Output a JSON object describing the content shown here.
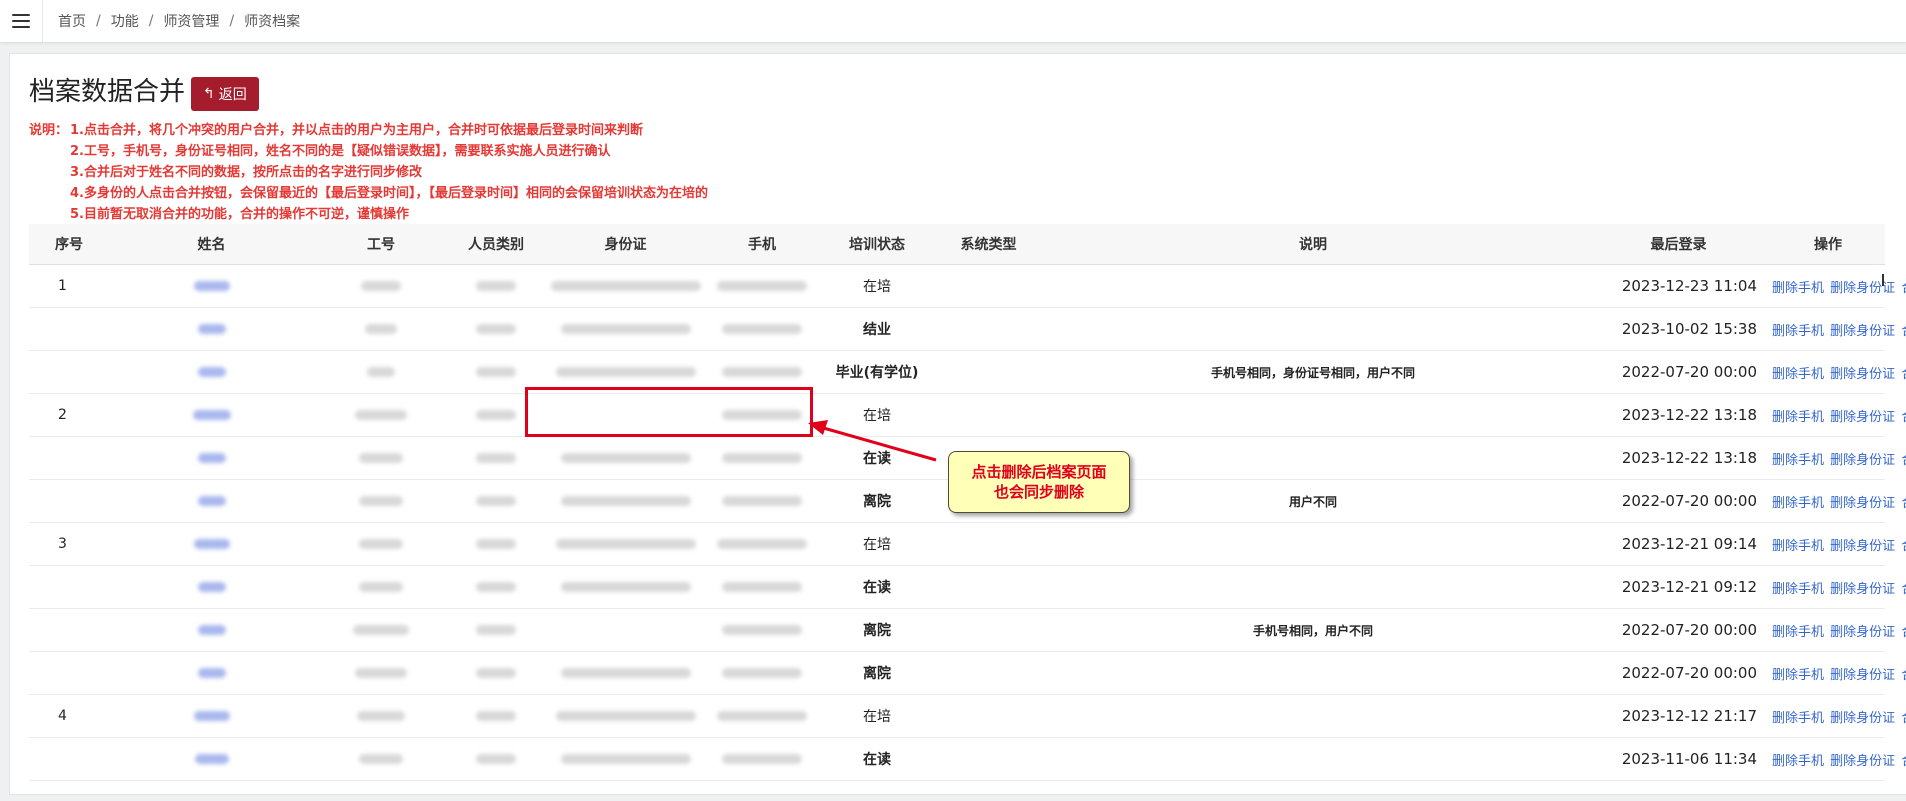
{
  "breadcrumb": [
    "首页",
    "功能",
    "师资管理",
    "师资档案"
  ],
  "page": {
    "title": "档案数据合并",
    "back_label": "返回"
  },
  "notes": {
    "lead": "说明：",
    "lines": [
      "1.点击合并，将几个冲突的用户合并，并以点击的用户为主用户，合并时可依据最后登录时间来判断",
      "2.工号，手机号，身份证号相同，姓名不同的是【疑似错误数据】，需要联系实施人员进行确认",
      "3.合并后对于姓名不同的数据，按所点击的名字进行同步修改",
      "4.多身份的人点击合并按钮，会保留最近的【最后登录时间】，【最后登录时间】相同的会保留培训状态为在培的",
      "5.目前暂无取消合并的功能，合并的操作不可逆，谨慎操作"
    ]
  },
  "table": {
    "headers": [
      "序号",
      "姓名",
      "工号",
      "人员类别",
      "身份证",
      "手机",
      "培训状态",
      "系统类型",
      "说明",
      "最后登录",
      "操作"
    ],
    "ops": [
      "删除手机",
      "删除身份证",
      "合并"
    ],
    "rows": [
      {
        "seq": "1",
        "status": "在培",
        "remark": "",
        "time": "2023-12-23 11:04"
      },
      {
        "seq": "",
        "status": "结业",
        "remark": "",
        "time": "2023-10-02 15:38"
      },
      {
        "seq": "",
        "status": "毕业(有学位)",
        "remark": "手机号相同，身份证号相同，用户不同",
        "time": "2022-07-20 00:00"
      },
      {
        "seq": "2",
        "status": "在培",
        "remark": "",
        "time": "2023-12-22 13:18"
      },
      {
        "seq": "",
        "status": "在读",
        "remark": "",
        "time": "2023-12-22 13:18"
      },
      {
        "seq": "",
        "status": "离院",
        "remark": "用户不同",
        "time": "2022-07-20 00:00"
      },
      {
        "seq": "3",
        "status": "在培",
        "remark": "",
        "time": "2023-12-21 09:14"
      },
      {
        "seq": "",
        "status": "在读",
        "remark": "",
        "time": "2023-12-21 09:12"
      },
      {
        "seq": "",
        "status": "离院",
        "remark": "手机号相同，用户不同",
        "time": "2022-07-20 00:00"
      },
      {
        "seq": "",
        "status": "离院",
        "remark": "",
        "time": "2022-07-20 00:00"
      },
      {
        "seq": "4",
        "status": "在培",
        "remark": "",
        "time": "2023-12-12 21:17"
      },
      {
        "seq": "",
        "status": "在读",
        "remark": "",
        "time": "2023-11-06 11:34"
      }
    ]
  },
  "callout": {
    "line1": "点击删除后档案页面",
    "line2": "也会同步删除"
  },
  "colors": {
    "accent_button": "#a51d2d",
    "note_red": "#e53935",
    "link_blue": "#3366cc",
    "callout_bg": "#ffffb8"
  }
}
